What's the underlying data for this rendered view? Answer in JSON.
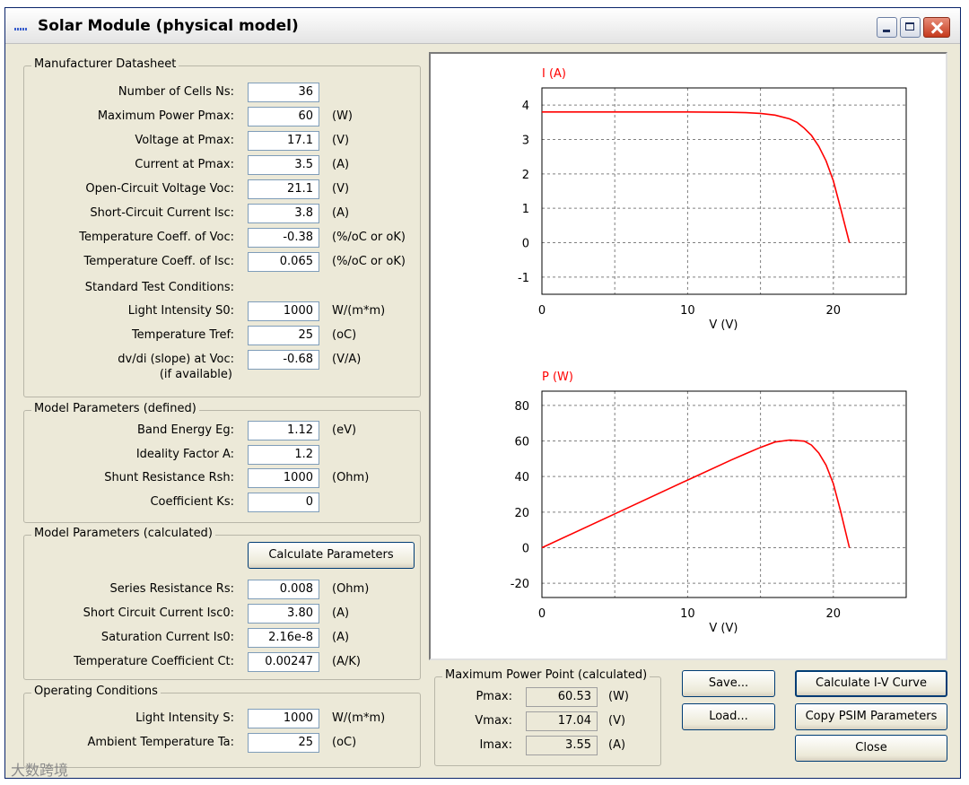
{
  "window": {
    "title": "Solar Module (physical model)",
    "minimize": "_",
    "maximize": "□",
    "close": "×"
  },
  "datasheet": {
    "legend": "Manufacturer Datasheet",
    "rows": [
      {
        "label": "Number of Cells Ns:",
        "value": "36",
        "unit": ""
      },
      {
        "label": "Maximum Power Pmax:",
        "value": "60",
        "unit": "(W)"
      },
      {
        "label": "Voltage at Pmax:",
        "value": "17.1",
        "unit": "(V)"
      },
      {
        "label": "Current at Pmax:",
        "value": "3.5",
        "unit": "(A)"
      },
      {
        "label": "Open-Circuit Voltage Voc:",
        "value": "21.1",
        "unit": "(V)"
      },
      {
        "label": "Short-Circuit Current Isc:",
        "value": "3.8",
        "unit": "(A)"
      },
      {
        "label": "Temperature Coeff. of Voc:",
        "value": "-0.38",
        "unit": "(%/oC or oK)"
      },
      {
        "label": "Temperature Coeff. of Isc:",
        "value": "0.065",
        "unit": "(%/oC or oK)"
      }
    ],
    "stc_label": "Standard Test Conditions:",
    "stc_rows": [
      {
        "label": "Light Intensity S0:",
        "value": "1000",
        "unit": "W/(m*m)"
      },
      {
        "label": "Temperature Tref:",
        "value": "25",
        "unit": "(oC)"
      },
      {
        "label": "dv/di (slope) at Voc:",
        "value": "-0.68",
        "unit": "(V/A)"
      }
    ],
    "slope_note": "(if available)"
  },
  "model_defined": {
    "legend": "Model Parameters (defined)",
    "rows": [
      {
        "label": "Band Energy Eg:",
        "value": "1.12",
        "unit": "(eV)"
      },
      {
        "label": "Ideality Factor A:",
        "value": "1.2",
        "unit": ""
      },
      {
        "label": "Shunt Resistance Rsh:",
        "value": "1000",
        "unit": "(Ohm)"
      },
      {
        "label": "Coefficient Ks:",
        "value": "0",
        "unit": ""
      }
    ]
  },
  "model_calculated": {
    "legend": "Model Parameters (calculated)",
    "button": "Calculate Parameters",
    "rows": [
      {
        "label": "Series Resistance Rs:",
        "value": "0.008",
        "unit": "(Ohm)"
      },
      {
        "label": "Short Circuit Current Isc0:",
        "value": "3.80",
        "unit": "(A)"
      },
      {
        "label": "Saturation Current Is0:",
        "value": "2.16e-8",
        "unit": "(A)"
      },
      {
        "label": "Temperature Coefficient Ct:",
        "value": "0.00247",
        "unit": "(A/K)"
      }
    ]
  },
  "operating": {
    "legend": "Operating Conditions",
    "rows": [
      {
        "label": "Light Intensity S:",
        "value": "1000",
        "unit": "W/(m*m)"
      },
      {
        "label": "Ambient Temperature Ta:",
        "value": "25",
        "unit": "(oC)"
      }
    ]
  },
  "mpp": {
    "legend": "Maximum Power Point (calculated)",
    "rows": [
      {
        "label": "Pmax:",
        "value": "60.53",
        "unit": "(W)"
      },
      {
        "label": "Vmax:",
        "value": "17.04",
        "unit": "(V)"
      },
      {
        "label": "Imax:",
        "value": "3.55",
        "unit": "(A)"
      }
    ]
  },
  "buttons": {
    "save": "Save...",
    "load": "Load...",
    "calc_iv": "Calculate I-V Curve",
    "copy_psim": "Copy PSIM Parameters",
    "close": "Close"
  },
  "watermark": "大数跨境",
  "colors": {
    "curve": "#ff0000",
    "grid": "#808080"
  },
  "chart_data": [
    {
      "type": "line",
      "ylabel": "I (A)",
      "xlabel": "V (V)",
      "xlim": [
        0,
        25
      ],
      "ylim": [
        -1.5,
        4.5
      ],
      "xticks": [
        0,
        10,
        20
      ],
      "yticks": [
        -1,
        0,
        1,
        2,
        3,
        4
      ],
      "grid": true,
      "series": [
        {
          "x": [
            0,
            5,
            10,
            13,
            14,
            15,
            16,
            17,
            17.5,
            18,
            18.5,
            19,
            19.5,
            20,
            20.5,
            21.1
          ],
          "y": [
            3.8,
            3.8,
            3.8,
            3.79,
            3.78,
            3.76,
            3.71,
            3.6,
            3.5,
            3.33,
            3.12,
            2.8,
            2.38,
            1.8,
            1.0,
            0
          ]
        }
      ]
    },
    {
      "type": "line",
      "ylabel": "P (W)",
      "xlabel": "V (V)",
      "xlim": [
        0,
        25
      ],
      "ylim": [
        -28,
        88
      ],
      "xticks": [
        0,
        10,
        20
      ],
      "yticks": [
        -20,
        0,
        20,
        40,
        60,
        80
      ],
      "grid": true,
      "series": [
        {
          "x": [
            0,
            5,
            10,
            13,
            14,
            15,
            16,
            17,
            17.5,
            18,
            18.5,
            19,
            19.5,
            20,
            20.5,
            21.1
          ],
          "y": [
            0,
            19,
            38,
            49.3,
            52.9,
            56.4,
            59.4,
            60.5,
            60.2,
            59.9,
            57.7,
            53.2,
            46.4,
            36,
            20.5,
            0
          ]
        }
      ]
    }
  ]
}
